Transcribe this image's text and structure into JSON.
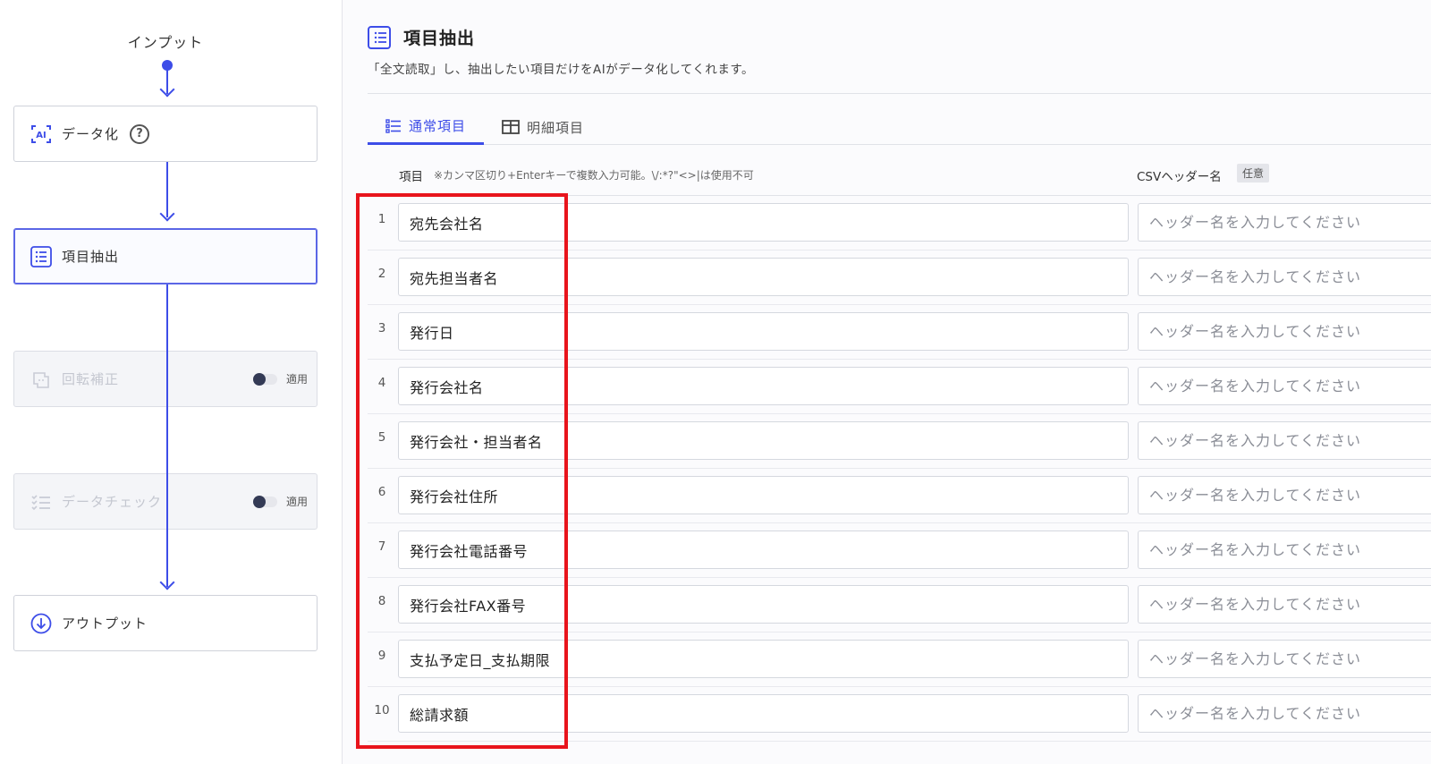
{
  "flow": {
    "input_label": "インプット",
    "nodes": [
      {
        "label": "データ化",
        "icon": "ai-scan-icon"
      },
      {
        "label": "項目抽出",
        "icon": "list-icon"
      },
      {
        "label": "回転補正",
        "icon": "rotate-doc-icon",
        "toggle_label": "適用"
      },
      {
        "label": "データチェック",
        "icon": "checklist-icon",
        "toggle_label": "適用"
      },
      {
        "label": "アウトプット",
        "icon": "download-circle-icon"
      }
    ]
  },
  "main": {
    "title": "項目抽出",
    "subtitle": "「全文読取」し、抽出したい項目だけをAIがデータ化してくれます。",
    "tabs": [
      {
        "label": "通常項目",
        "active": true
      },
      {
        "label": "明細項目",
        "active": false
      }
    ],
    "columns": {
      "items": "項目",
      "items_note": "※カンマ区切り+Enterキーで複数入力可能。\\/:*?\"<>|は使用不可",
      "csv_header": "CSVヘッダー名",
      "optional": "任意"
    },
    "rows": [
      {
        "num": "1",
        "item": "宛先会社名",
        "csv_placeholder": "ヘッダー名を入力してください"
      },
      {
        "num": "2",
        "item": "宛先担当者名",
        "csv_placeholder": "ヘッダー名を入力してください"
      },
      {
        "num": "3",
        "item": "発行日",
        "csv_placeholder": "ヘッダー名を入力してください"
      },
      {
        "num": "4",
        "item": "発行会社名",
        "csv_placeholder": "ヘッダー名を入力してください"
      },
      {
        "num": "5",
        "item": "発行会社・担当者名",
        "csv_placeholder": "ヘッダー名を入力してください"
      },
      {
        "num": "6",
        "item": "発行会社住所",
        "csv_placeholder": "ヘッダー名を入力してください"
      },
      {
        "num": "7",
        "item": "発行会社電話番号",
        "csv_placeholder": "ヘッダー名を入力してください"
      },
      {
        "num": "8",
        "item": "発行会社FAX番号",
        "csv_placeholder": "ヘッダー名を入力してください"
      },
      {
        "num": "9",
        "item": "支払予定日_支払期限",
        "csv_placeholder": "ヘッダー名を入力してください"
      },
      {
        "num": "10",
        "item": "総請求額",
        "csv_placeholder": "ヘッダー名を入力してください"
      }
    ]
  },
  "colors": {
    "accent": "#3d4de8",
    "highlight": "#e8141c"
  }
}
